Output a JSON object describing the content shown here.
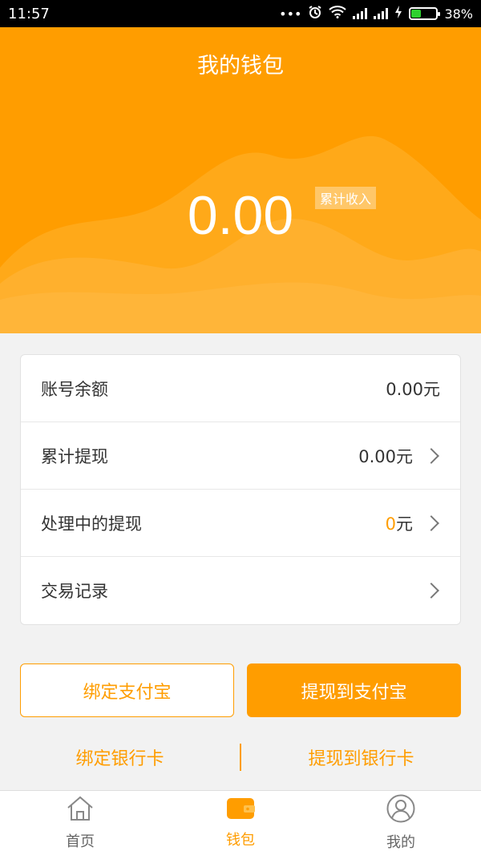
{
  "status_bar": {
    "time": "11:57",
    "battery_percent": "38%",
    "battery_level": 0.38,
    "icons": [
      "dots-icon",
      "alarm-icon",
      "wifi-icon",
      "signal-icon",
      "signal-icon",
      "charging-icon",
      "battery-icon"
    ]
  },
  "header": {
    "title": "我的钱包",
    "amount": "0.00",
    "badge": "累计收入"
  },
  "card": {
    "rows": [
      {
        "label": "账号余额",
        "value": "0.00元",
        "has_chevron": false
      },
      {
        "label": "累计提现",
        "value": "0.00元",
        "has_chevron": true
      },
      {
        "label": "处理中的提现",
        "value_number": "0",
        "value_unit": "元",
        "has_chevron": true
      },
      {
        "label": "交易记录",
        "value": "",
        "has_chevron": true
      }
    ]
  },
  "actions": {
    "bind_alipay": "绑定支付宝",
    "withdraw_alipay": "提现到支付宝",
    "bind_bank": "绑定银行卡",
    "withdraw_bank": "提现到银行卡"
  },
  "nav": {
    "tabs": [
      {
        "label": "首页",
        "icon": "home-icon",
        "active": false
      },
      {
        "label": "钱包",
        "icon": "wallet-icon",
        "active": true
      },
      {
        "label": "我的",
        "icon": "user-icon",
        "active": false
      }
    ]
  },
  "colors": {
    "accent": "#ff9d00",
    "background": "#f2f2f2"
  }
}
